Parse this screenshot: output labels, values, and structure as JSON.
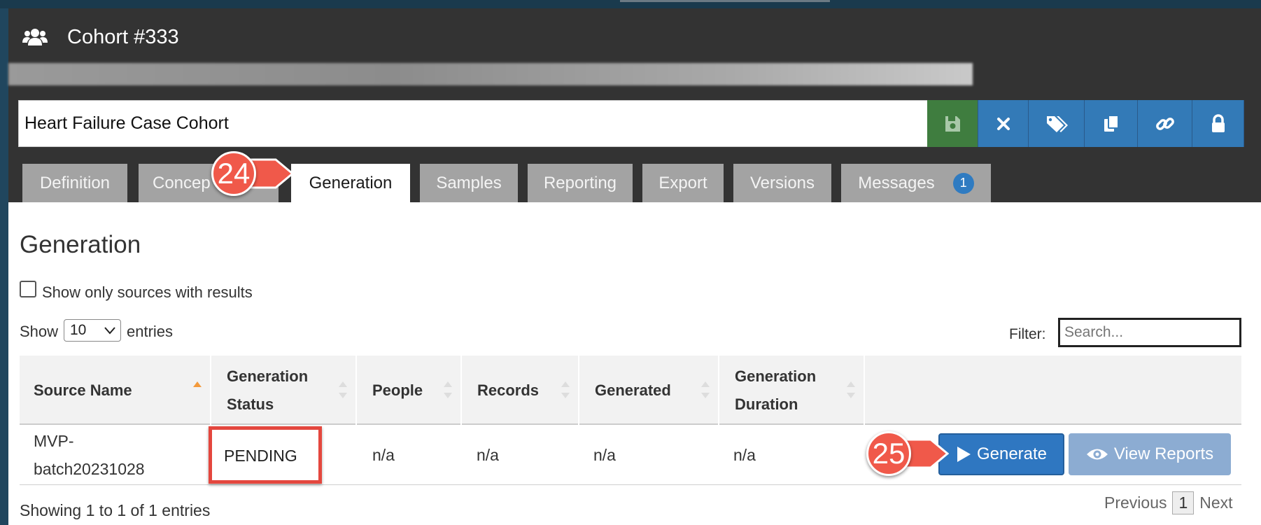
{
  "window": {
    "title": "Cohort #333"
  },
  "cohort": {
    "name": "Heart Failure Case Cohort"
  },
  "toolbar": {
    "buttons": [
      {
        "name": "save",
        "icon": "floppy-disk-icon",
        "color": "#3f7d3f"
      },
      {
        "name": "close",
        "icon": "close-icon",
        "color": "#337ab7"
      },
      {
        "name": "tags",
        "icon": "tags-icon",
        "color": "#337ab7"
      },
      {
        "name": "copy",
        "icon": "copy-icon",
        "color": "#337ab7"
      },
      {
        "name": "link",
        "icon": "link-icon",
        "color": "#337ab7"
      },
      {
        "name": "lock",
        "icon": "lock-icon",
        "color": "#337ab7"
      }
    ]
  },
  "tabs": [
    {
      "label": "Definition"
    },
    {
      "label": "Concep"
    },
    {
      "label": "Generation",
      "active": true
    },
    {
      "label": "Samples"
    },
    {
      "label": "Reporting"
    },
    {
      "label": "Export"
    },
    {
      "label": "Versions"
    },
    {
      "label": "Messages",
      "badge": "1"
    }
  ],
  "generation": {
    "heading": "Generation",
    "checkbox_label": "Show only sources with results",
    "show_label": "Show",
    "entries_value": "10",
    "entries_label": "entries",
    "filter_label": "Filter:",
    "filter_placeholder": "Search...",
    "columns": [
      "Source Name",
      "Generation Status",
      "People",
      "Records",
      "Generated",
      "Generation Duration"
    ],
    "rows": [
      {
        "source_line1": "MVP-",
        "source_line2": "batch20231028",
        "status": "PENDING",
        "people": "n/a",
        "records": "n/a",
        "generated": "n/a",
        "duration": "n/a"
      }
    ],
    "generate_label": "Generate",
    "view_reports_label": "View Reports",
    "showing_text": "Showing 1 to 1 of 1 entries",
    "pager": {
      "previous": "Previous",
      "page": "1",
      "next": "Next"
    }
  },
  "callouts": {
    "first": "24",
    "second": "25"
  },
  "colors": {
    "accent": "#337ab7",
    "callout": "#f0594a",
    "highlight": "#e4473e",
    "header_bg": "#333333"
  }
}
